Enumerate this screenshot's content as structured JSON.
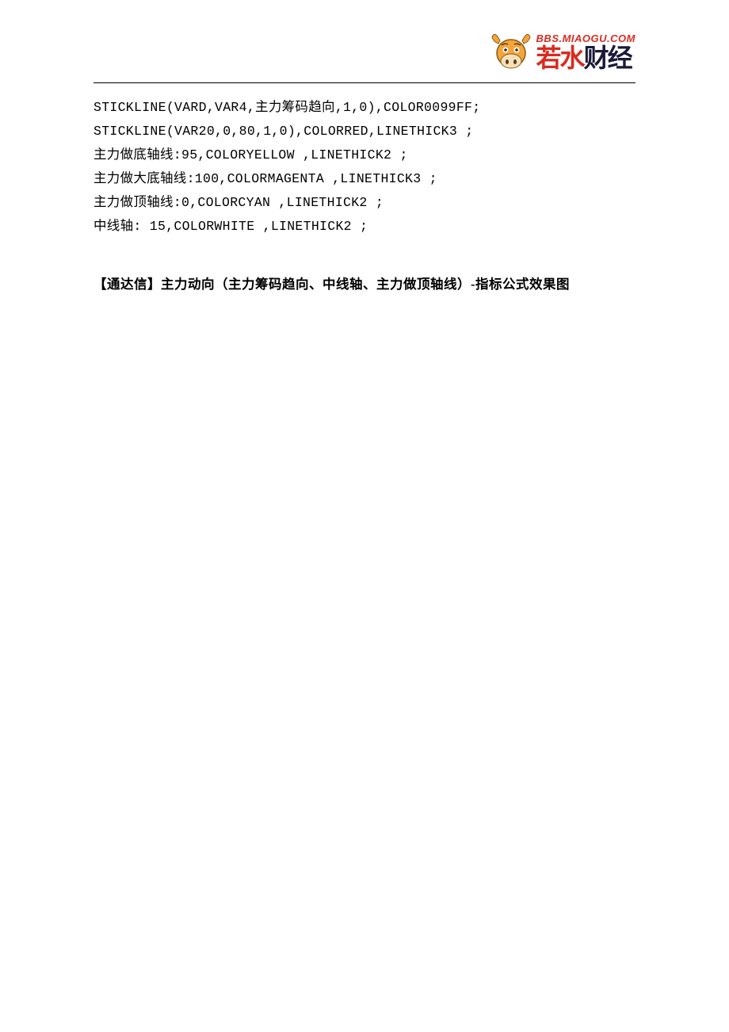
{
  "logo": {
    "url": "BBS.MIAOGU.COM",
    "cn1": "若水",
    "cn2": "财经"
  },
  "code": {
    "line1": "STICKLINE(VARD,VAR4,主力筹码趋向,1,0),COLOR0099FF;",
    "line2": "STICKLINE(VAR20,0,80,1,0),COLORRED,LINETHICK3 ;",
    "line3": "主力做底轴线:95,COLORYELLOW ,LINETHICK2 ;",
    "line4": "主力做大底轴线:100,COLORMAGENTA ,LINETHICK3 ;",
    "line5": "主力做顶轴线:0,COLORCYAN ,LINETHICK2 ;",
    "line6": "中线轴: 15,COLORWHITE ,LINETHICK2 ;"
  },
  "section_title": "【通达信】主力动向（主力筹码趋向、中线轴、主力做顶轴线）-指标公式效果图"
}
